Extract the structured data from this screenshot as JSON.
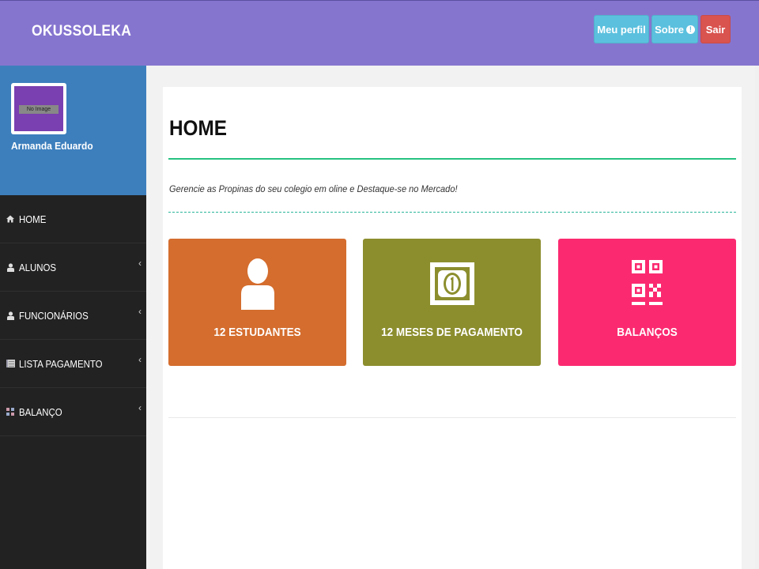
{
  "header": {
    "brand": "OKUSSOLEKA",
    "buttons": {
      "profile_label": "Meu perfil",
      "about_label": "Sobre",
      "logout_label": "Sair"
    }
  },
  "profile": {
    "avatar_placeholder": "No Image",
    "name": "Armanda Eduardo"
  },
  "sidebar": {
    "items": [
      {
        "label": "HOME",
        "icon": "home-icon"
      },
      {
        "label": "ALUNOS",
        "icon": "user-icon"
      },
      {
        "label": "FUNCIONÁRIOS",
        "icon": "user-icon"
      },
      {
        "label": "LISTA PAGAMENTO",
        "icon": "list-icon"
      },
      {
        "label": "BALANÇO",
        "icon": "grid-icon"
      }
    ]
  },
  "main": {
    "title": "HOME",
    "subtitle": "Gerencie as Propinas do seu colegio em oline e Destaque-se no Mercado!",
    "tiles": [
      {
        "label": "12 ESTUDANTES",
        "icon": "user-icon"
      },
      {
        "label": "12 MESES DE PAGAMENTO",
        "icon": "money-bill-icon"
      },
      {
        "label": "BALANÇOS",
        "icon": "qrcode-icon"
      }
    ]
  },
  "colors": {
    "header": "#8675cf",
    "profile_bg": "#3d7fbd",
    "sidebar_bg": "#222222",
    "accent_rule": "#26c281",
    "tile_students": "#d46d2e",
    "tile_payments": "#8c8e2e",
    "tile_balance": "#fb2a70",
    "btn_info": "#5bc0de",
    "btn_danger": "#d9534f"
  }
}
